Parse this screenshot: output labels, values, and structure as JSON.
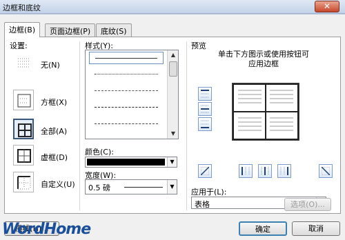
{
  "window": {
    "title": "边框和底纹",
    "close_glyph": "✕"
  },
  "tabs": [
    {
      "label": "边框(B)",
      "active": true
    },
    {
      "label": "页面边框(P)",
      "active": false
    },
    {
      "label": "底纹(S)",
      "active": false
    }
  ],
  "settings": {
    "heading": "设置:",
    "options": [
      {
        "label": "无(N)",
        "selected": false
      },
      {
        "label": "方框(X)",
        "selected": false
      },
      {
        "label": "全部(A)",
        "selected": true
      },
      {
        "label": "虚框(D)",
        "selected": false
      },
      {
        "label": "自定义(U)",
        "selected": false
      }
    ]
  },
  "style": {
    "heading": "样式(Y):",
    "items": [
      "solid",
      "dotted",
      "dashed-fine",
      "dashed",
      "dash-dot",
      "dash-dot-dot"
    ],
    "selected_index": 0
  },
  "color": {
    "label": "颜色(C):",
    "value": "#000000"
  },
  "width": {
    "label": "宽度(W):",
    "value": "0.5 磅"
  },
  "preview": {
    "heading": "预览",
    "hint": "单击下方图示或使用按钮可应用边框"
  },
  "apply_to": {
    "label": "应用于(L):",
    "value": "表格"
  },
  "buttons": {
    "options": "选项(O)...",
    "ok": "确定",
    "cancel": "取消",
    "horizontal_line": "横线(H)..."
  },
  "watermark": "WordHome",
  "colors": {
    "accent": "#39557a",
    "titlebar": "#c4d3e8"
  }
}
